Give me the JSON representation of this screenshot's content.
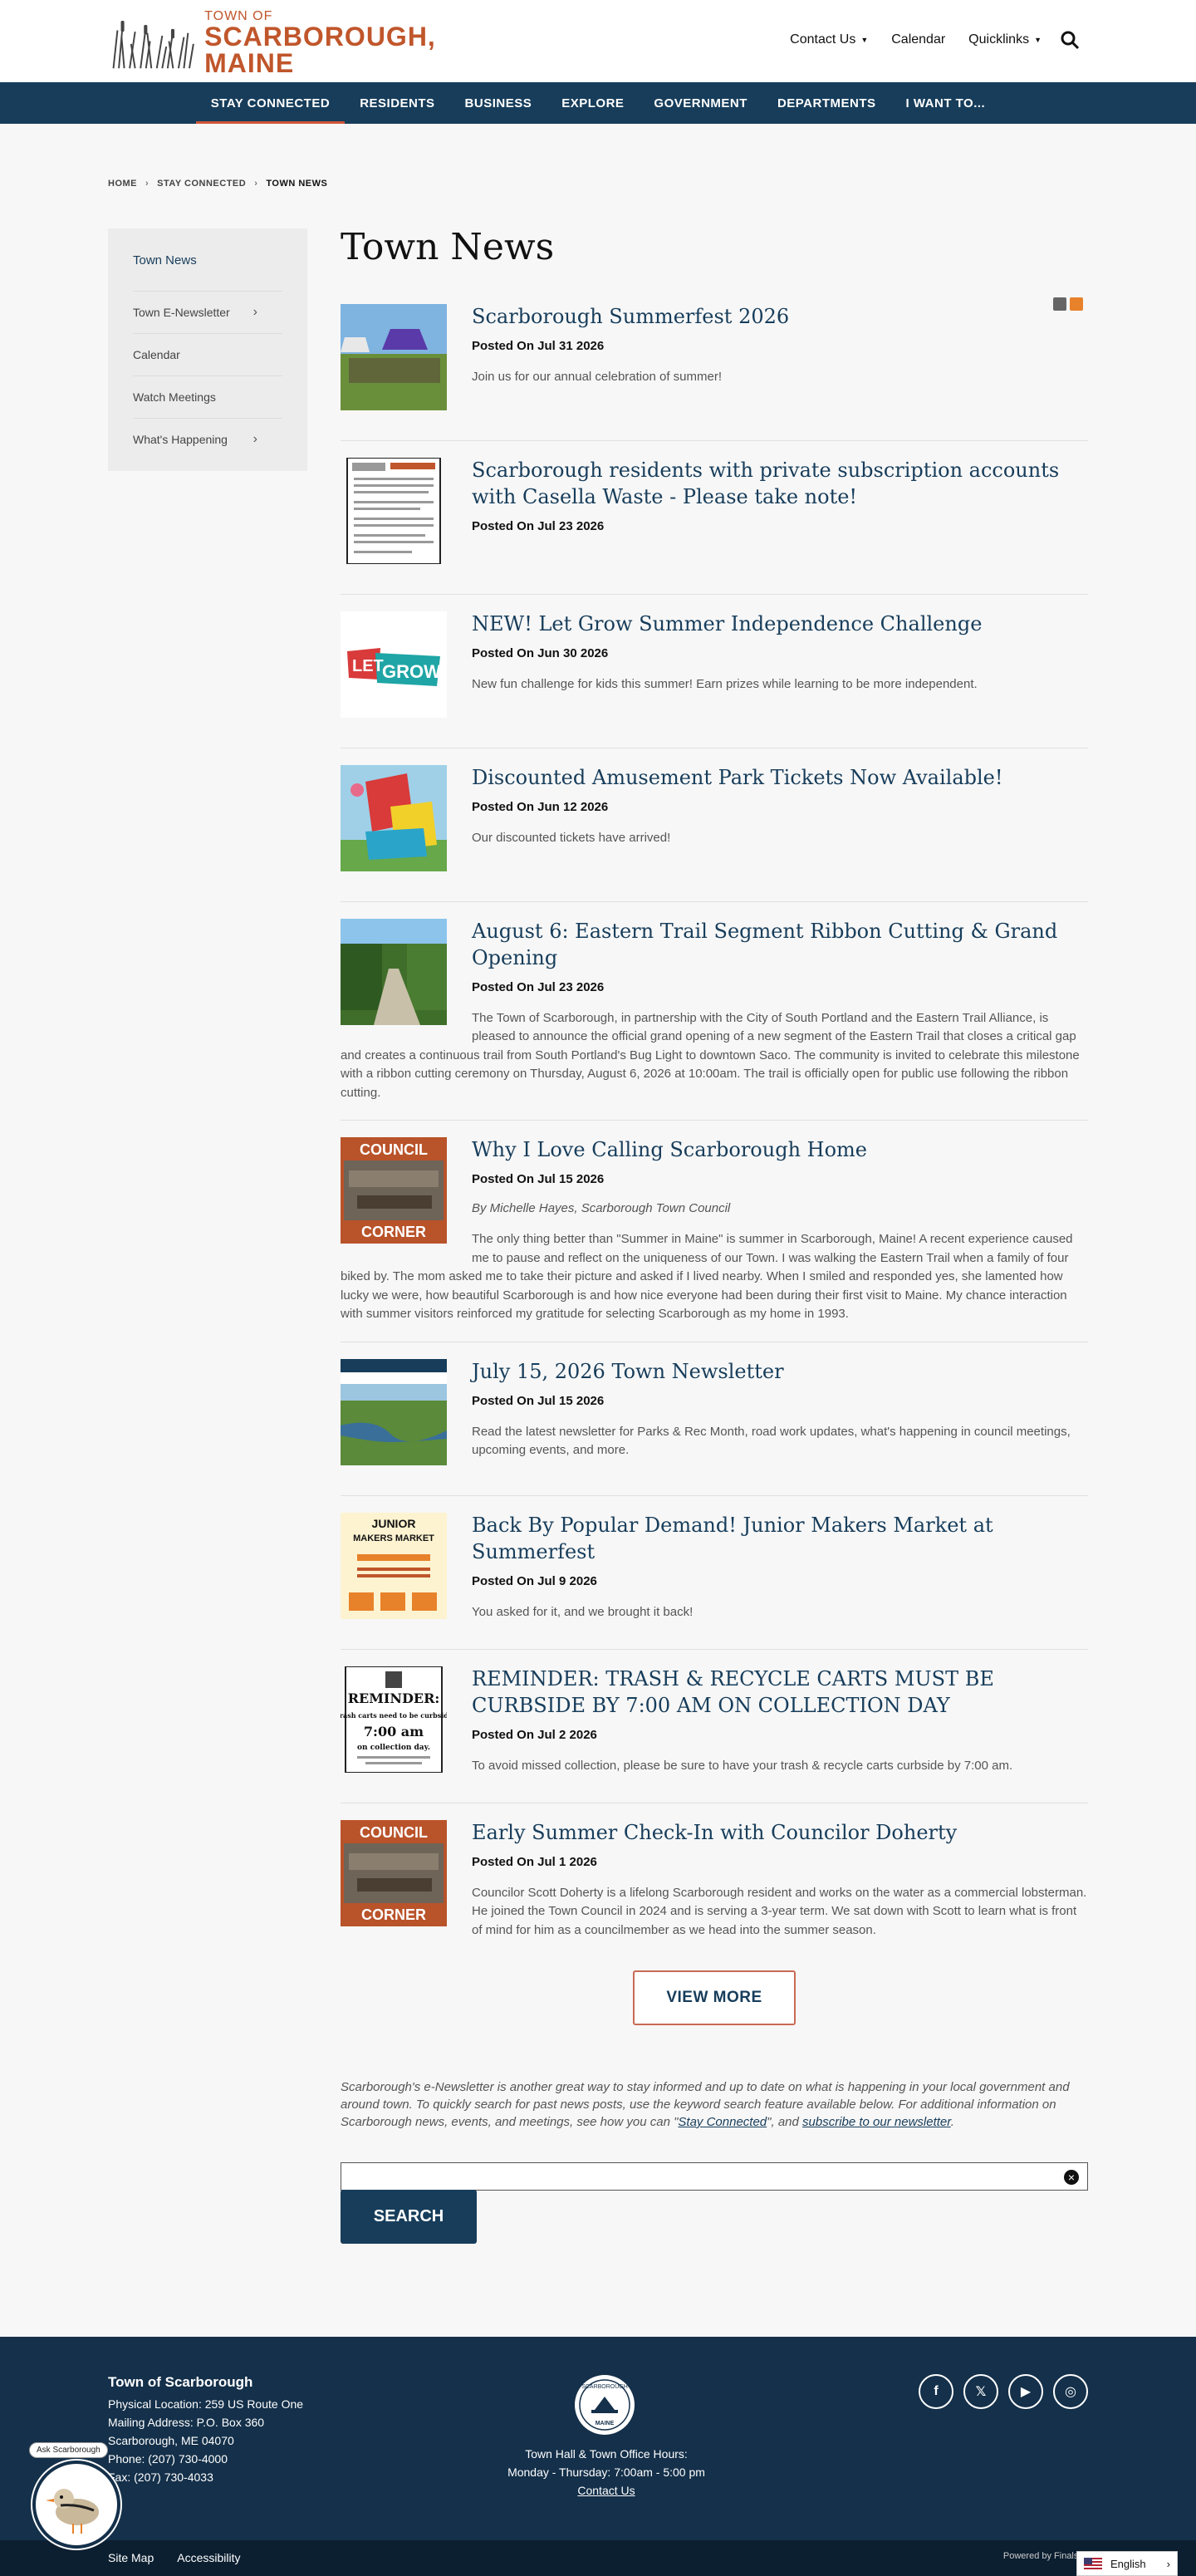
{
  "header": {
    "logo_small": "TOWN OF",
    "logo_big": "SCARBOROUGH, MAINE",
    "util": [
      "Contact Us",
      "Calendar",
      "Quicklinks"
    ]
  },
  "nav": [
    "STAY CONNECTED",
    "RESIDENTS",
    "BUSINESS",
    "EXPLORE",
    "GOVERNMENT",
    "DEPARTMENTS",
    "I WANT TO..."
  ],
  "breadcrumb": [
    "HOME",
    "STAY CONNECTED",
    "TOWN NEWS"
  ],
  "sidebar": {
    "title": "Town News",
    "items": [
      "Town E-Newsletter",
      "Calendar",
      "Watch Meetings",
      "What's Happening"
    ]
  },
  "page_title": "Town News",
  "news": [
    {
      "title": "Scarborough Summerfest 2026",
      "date": "Posted On Jul 31 2026",
      "desc": "Join us for our annual celebration of summer!"
    },
    {
      "title": "Scarborough residents with private subscription accounts with Casella Waste - Please take note!",
      "date": "Posted On Jul 23 2026",
      "desc": ""
    },
    {
      "title": "NEW! Let Grow Summer Independence Challenge",
      "date": "Posted On Jun 30 2026",
      "desc": "New fun challenge for kids this summer! Earn prizes while learning to be more independent."
    },
    {
      "title": "Discounted Amusement Park Tickets Now Available!",
      "date": "Posted On Jun 12 2026",
      "desc": "Our discounted tickets have arrived!"
    },
    {
      "title": "August 6: Eastern Trail Segment Ribbon Cutting & Grand Opening",
      "date": "Posted On Jul 23 2026",
      "desc": "The Town of Scarborough, in partnership with the City of South Portland and the Eastern Trail Alliance, is pleased to announce the official grand opening of a new segment of the Eastern Trail that closes a critical gap and creates a continuous trail from South Portland's Bug Light to downtown Saco. The community is invited to celebrate this milestone with a ribbon cutting ceremony on Thursday, August 6, 2026 at 10:00am. The trail is officially open for public use following the ribbon cutting."
    },
    {
      "title": "Why I Love Calling Scarborough Home",
      "date": "Posted On Jul 15 2026",
      "byline": "By Michelle Hayes, Scarborough Town Council",
      "desc": "The only thing better than \"Summer in Maine\" is summer in Scarborough, Maine! A recent experience caused me to pause and reflect on the uniqueness of our Town. I was walking the Eastern Trail when a family of four biked by. The mom asked me to take their picture and asked if I lived nearby. When I smiled and responded yes, she lamented how lucky we were, how beautiful Scarborough is and how nice everyone had been during their first visit to Maine. My chance interaction with summer visitors reinforced my gratitude for selecting Scarborough as my home in 1993."
    },
    {
      "title": "July 15, 2026 Town Newsletter",
      "date": "Posted On Jul 15 2026",
      "desc": "Read the latest newsletter for Parks & Rec Month, road work updates, what's happening in council meetings, upcoming events, and more."
    },
    {
      "title": "Back By Popular Demand! Junior Makers Market at Summerfest",
      "date": "Posted On Jul 9 2026",
      "desc": "You asked for it, and we brought it back!"
    },
    {
      "title": "REMINDER: TRASH & RECYCLE CARTS MUST BE CURBSIDE BY 7:00 AM ON COLLECTION DAY",
      "date": "Posted On Jul 2 2026",
      "desc": "To avoid missed collection, please be sure to have your trash & recycle carts curbside by 7:00 am."
    },
    {
      "title": "Early Summer Check-In with Councilor Doherty",
      "date": "Posted On Jul 1 2026",
      "desc": "Councilor Scott Doherty is a lifelong Scarborough resident and works on the water as a commercial lobsterman. He joined the Town Council in 2024 and is serving a 3-year term. We sat down with Scott to learn what is front of mind for him as a councilmember as we head into the summer season."
    }
  ],
  "view_more": "VIEW MORE",
  "enews": {
    "text": "Scarborough's e-Newsletter is another great way to stay informed and up to date on what is happening in your local government and around town. To quickly search for past news posts, use the keyword search feature available below. For additional information on Scarborough news, events, and meetings, see how you can \"",
    "link1": "Stay Connected",
    "mid": "\", and ",
    "link2": "subscribe to our newsletter",
    "end": "."
  },
  "search_button": "SEARCH",
  "thumbs": {
    "council": [
      "COUNCIL",
      "CORNER"
    ],
    "letgrow": [
      "LET",
      "GROW"
    ],
    "junior": [
      "JUNIOR",
      "MAKERS MARKET"
    ],
    "reminder": [
      "REMINDER:",
      "All trash carts need to be curbside by",
      "7:00 am",
      "on collection day."
    ]
  },
  "footer": {
    "name": "Town of Scarborough",
    "lines": [
      "Physical Location: 259 US Route One",
      "Mailing Address: P.O. Box 360",
      "Scarborough, ME 04070",
      "Phone: (207) 730-4000",
      "Fax: (207) 730-4033"
    ],
    "hours_title": "Town Hall & Town Office Hours:",
    "hours": "Monday - Thursday: 7:00am - 5:00 pm",
    "contact": "Contact Us",
    "seal_text": [
      "SCARBOROUGH",
      "MAINE"
    ],
    "links": [
      "Site Map",
      "Accessibility"
    ],
    "powered": "Powered by Finalsite",
    "language": "English",
    "chat_label": "Ask Scarborough"
  }
}
